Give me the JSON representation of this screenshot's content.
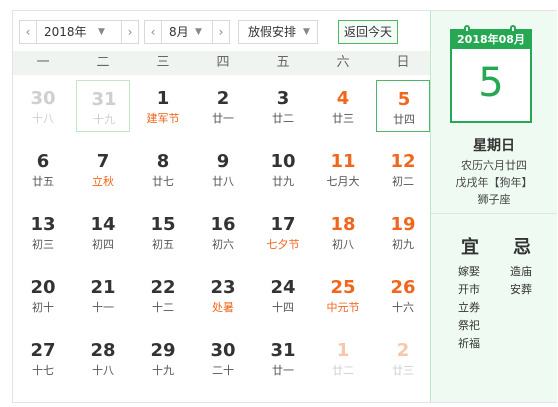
{
  "toolbar": {
    "year_value": "2018年",
    "month_value": "8月",
    "holiday_value": "放假安排",
    "today_label": "返回今天",
    "prev": "‹",
    "next": "›",
    "caret": "▼"
  },
  "weekdays": [
    "一",
    "二",
    "三",
    "四",
    "五",
    "六",
    "日"
  ],
  "weeks": [
    [
      {
        "day": "30",
        "lunar": "十八",
        "other": true
      },
      {
        "day": "31",
        "lunar": "十九",
        "other": true
      },
      {
        "day": "1",
        "lunar": "建军节",
        "holiday": true
      },
      {
        "day": "2",
        "lunar": "廿一"
      },
      {
        "day": "3",
        "lunar": "廿二"
      },
      {
        "day": "4",
        "lunar": "廿三"
      },
      {
        "day": "5",
        "lunar": "廿四",
        "selected": true
      }
    ],
    [
      {
        "day": "6",
        "lunar": "廿五"
      },
      {
        "day": "7",
        "lunar": "立秋",
        "holiday": true
      },
      {
        "day": "8",
        "lunar": "廿七"
      },
      {
        "day": "9",
        "lunar": "廿八"
      },
      {
        "day": "10",
        "lunar": "廿九"
      },
      {
        "day": "11",
        "lunar": "七月大"
      },
      {
        "day": "12",
        "lunar": "初二"
      }
    ],
    [
      {
        "day": "13",
        "lunar": "初三"
      },
      {
        "day": "14",
        "lunar": "初四"
      },
      {
        "day": "15",
        "lunar": "初五"
      },
      {
        "day": "16",
        "lunar": "初六"
      },
      {
        "day": "17",
        "lunar": "七夕节",
        "holiday": true
      },
      {
        "day": "18",
        "lunar": "初八"
      },
      {
        "day": "19",
        "lunar": "初九"
      }
    ],
    [
      {
        "day": "20",
        "lunar": "初十"
      },
      {
        "day": "21",
        "lunar": "十一"
      },
      {
        "day": "22",
        "lunar": "十二"
      },
      {
        "day": "23",
        "lunar": "处暑",
        "holiday": true
      },
      {
        "day": "24",
        "lunar": "十四"
      },
      {
        "day": "25",
        "lunar": "中元节",
        "holiday": true
      },
      {
        "day": "26",
        "lunar": "十六"
      }
    ],
    [
      {
        "day": "27",
        "lunar": "十七"
      },
      {
        "day": "28",
        "lunar": "十八"
      },
      {
        "day": "29",
        "lunar": "十九"
      },
      {
        "day": "30",
        "lunar": "二十"
      },
      {
        "day": "31",
        "lunar": "廿一"
      },
      {
        "day": "1",
        "lunar": "廿二",
        "other": true
      },
      {
        "day": "2",
        "lunar": "廿三",
        "other": true
      }
    ]
  ],
  "detail": {
    "header": "2018年08月",
    "day": "5",
    "weekday": "星期日",
    "lunar_date": "农历六月廿四",
    "ganzhi": "戊戌年【狗年】",
    "zodiac": "狮子座"
  },
  "yi_ji": {
    "yi_title": "宜",
    "ji_title": "忌",
    "yi": [
      "嫁娶",
      "开市",
      "立券",
      "祭祀",
      "祈福"
    ],
    "ji": [
      "造庙",
      "安葬"
    ]
  },
  "colors": {
    "accent": "#26a853",
    "weekend": "#f0661c",
    "panel_bg": "#effaf2"
  }
}
